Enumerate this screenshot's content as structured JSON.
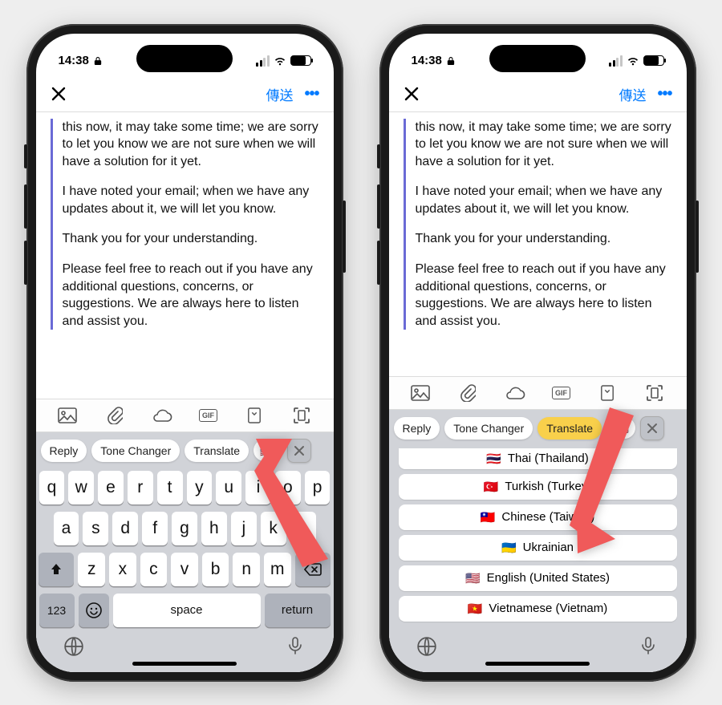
{
  "status": {
    "time": "14:38",
    "time2": "14:38"
  },
  "nav": {
    "send": "傳送"
  },
  "email": {
    "p1": "this now, it may take some time; we are sorry to let you know we are not sure when we will have a solution for it yet.",
    "p2": "I have noted your email; when we have any updates about it, we will let you know.",
    "p3": "Thank you for your understanding.",
    "p4": "Please feel free to reach out if you have any additional questions, concerns, or suggestions. We are always here to listen and assist you."
  },
  "attach": {
    "gif": "GIF"
  },
  "chips": {
    "reply": "Reply",
    "tone": "Tone Changer",
    "translate": "Translate",
    "flag": "🇺🇸"
  },
  "keyboard": {
    "row1": [
      "q",
      "w",
      "e",
      "r",
      "t",
      "y",
      "u",
      "i",
      "o",
      "p"
    ],
    "row2": [
      "a",
      "s",
      "d",
      "f",
      "g",
      "h",
      "j",
      "k",
      "l"
    ],
    "row3": [
      "z",
      "x",
      "c",
      "v",
      "b",
      "n",
      "m"
    ],
    "num": "123",
    "space": "space",
    "return": "return"
  },
  "languages": [
    {
      "flag": "🇹🇭",
      "label": "Thai (Thailand)"
    },
    {
      "flag": "🇹🇷",
      "label": "Turkish (Turkey)"
    },
    {
      "flag": "🇹🇼",
      "label": "Chinese (Taiwan)"
    },
    {
      "flag": "🇺🇦",
      "label": "Ukrainian"
    },
    {
      "flag": "🇺🇸",
      "label": "English (United States)"
    },
    {
      "flag": "🇻🇳",
      "label": "Vietnamese (Vietnam)"
    }
  ]
}
